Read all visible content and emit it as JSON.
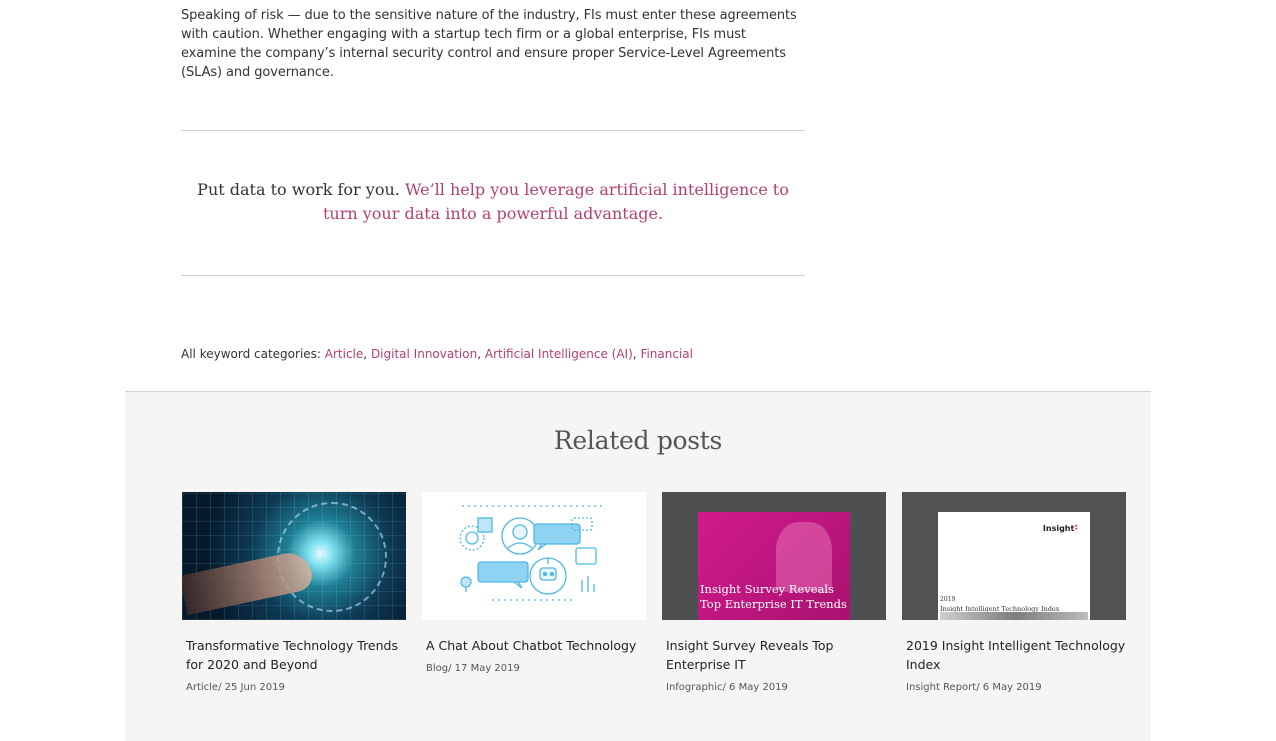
{
  "article": {
    "paragraph": "Speaking of risk — due to the sensitive nature of the industry, FIs must enter these agreements with caution. Whether engaging with a startup tech firm or a global enterprise, FIs must examine the company’s internal security control and ensure proper Service-Level Agreements (SLAs) and governance."
  },
  "callout": {
    "lead": "Put data to work for you.",
    "link": "We’ll help you leverage artificial intelligence to turn your data into a powerful advantage."
  },
  "keywords": {
    "label": "All keyword categories:",
    "items": [
      "Article",
      "Digital Innovation",
      "Artificial Intelligence (AI)",
      "Financial"
    ]
  },
  "related": {
    "heading": "Related posts",
    "cards": [
      {
        "title": "Transformative Technology Trends for 2020 and Beyond",
        "type": "Article",
        "date": "25 Jun 2019"
      },
      {
        "title": "A Chat About Chatbot Technology",
        "type": "Blog",
        "date": "17 May 2019"
      },
      {
        "title": "Insight Survey Reveals Top Enterprise IT",
        "type": "Infographic",
        "date": "6 May 2019",
        "thumb_text": "Insight Survey Reveals Top Enterprise IT Trends"
      },
      {
        "title": "2019 Insight Intelligent Technology Index",
        "type": "Insight Report",
        "date": "6 May 2019",
        "thumb_logo": "Insight",
        "thumb_year": "2019",
        "thumb_title": "Insight Intelligent Technology Index"
      }
    ]
  },
  "colors": {
    "accent": "#b3406e",
    "related_bg": "#f6f5f3",
    "magenta": "#d21a8e"
  }
}
